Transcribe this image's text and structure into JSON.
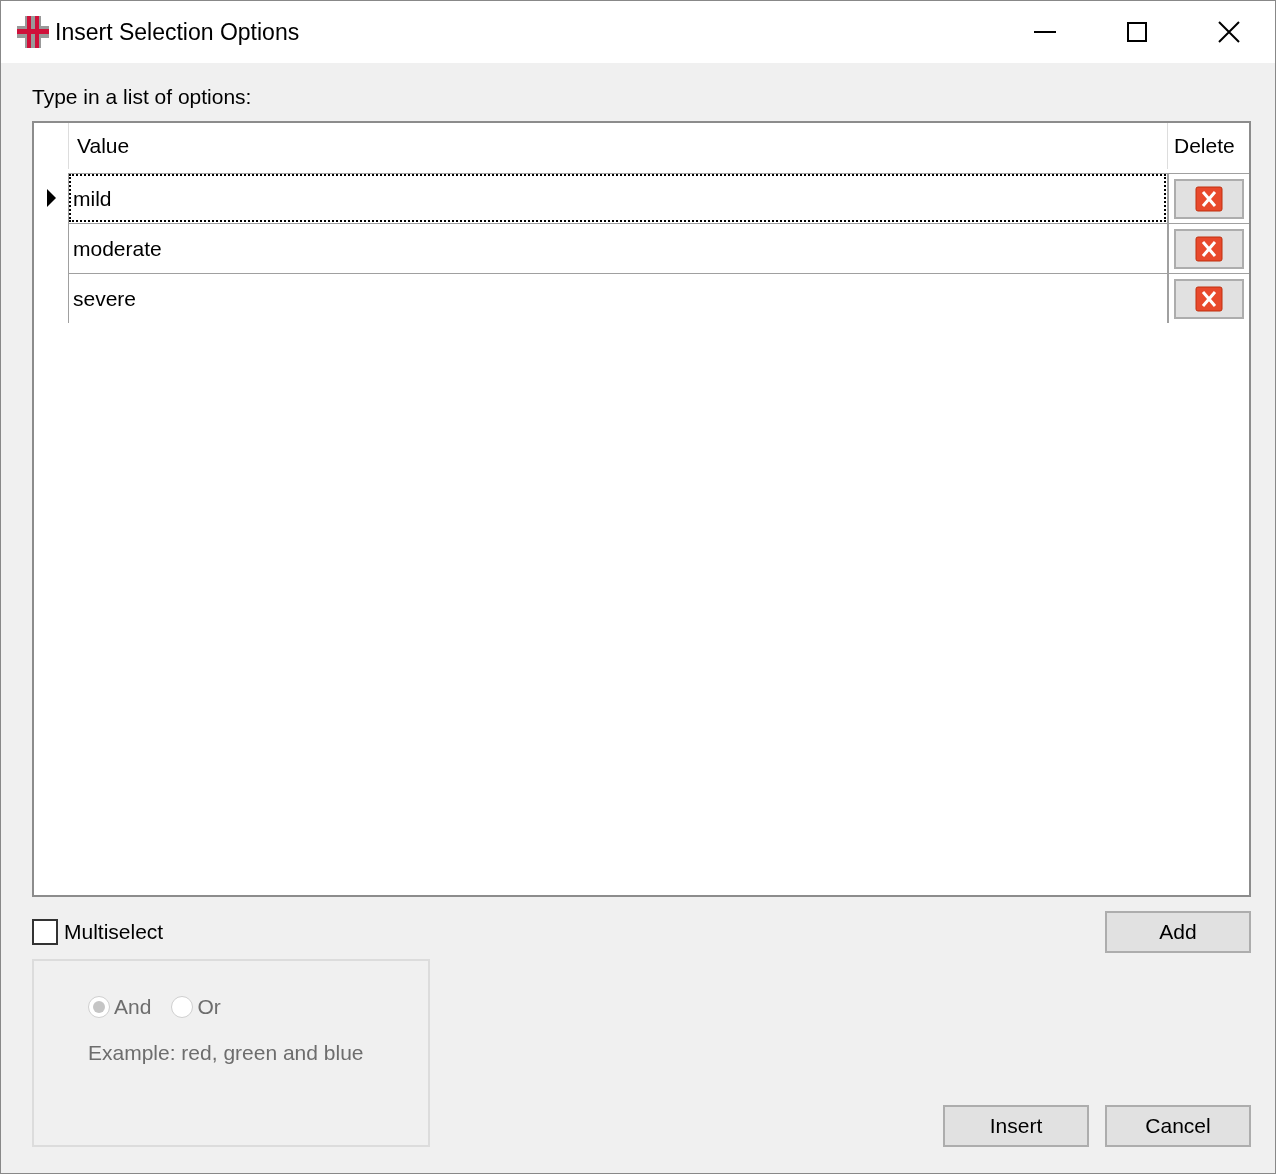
{
  "window": {
    "title": "Insert Selection Options"
  },
  "prompt": "Type in a list of options:",
  "grid": {
    "columns": [
      "Value",
      "Delete"
    ],
    "rows": [
      {
        "value": "mild",
        "selected": true
      },
      {
        "value": "moderate",
        "selected": false
      },
      {
        "value": "severe",
        "selected": false
      }
    ]
  },
  "multiselect": {
    "label": "Multiselect",
    "checked": false
  },
  "add_button": "Add",
  "options_group": {
    "disabled": true,
    "radios": [
      {
        "label": "And",
        "selected": true
      },
      {
        "label": "Or",
        "selected": false
      }
    ],
    "example": "Example: red, green and blue"
  },
  "footer_buttons": [
    "Insert",
    "Cancel"
  ]
}
